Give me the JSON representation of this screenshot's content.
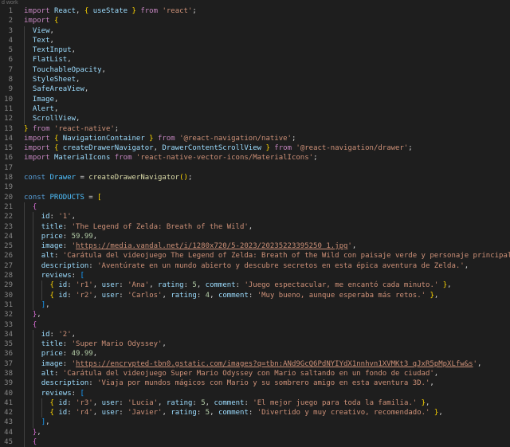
{
  "window": {
    "title": "d work"
  },
  "colors": {
    "background": "#1e1e1e",
    "line_number": "#858585",
    "keyword": "#c586c0",
    "declaration": "#569cd6",
    "variable": "#9cdcfe",
    "constant": "#4fc1ff",
    "function": "#dcdcaa",
    "type": "#4ec9b0",
    "string": "#ce9178",
    "number": "#b5cea8",
    "text": "#d4d4d4"
  },
  "editor": {
    "lines": [
      {
        "n": "1",
        "indent": 0,
        "tokens": [
          [
            "keyword",
            "import "
          ],
          [
            "var",
            "React"
          ],
          [
            "punct",
            ", "
          ],
          [
            "bracket1",
            "{ "
          ],
          [
            "var",
            "useState"
          ],
          [
            "bracket1",
            " }"
          ],
          [
            "keyword",
            " from "
          ],
          [
            "string",
            "'react'"
          ],
          [
            "punct",
            ";"
          ]
        ]
      },
      {
        "n": "2",
        "indent": 0,
        "tokens": [
          [
            "keyword",
            "import "
          ],
          [
            "bracket1",
            "{"
          ]
        ]
      },
      {
        "n": "3",
        "indent": 1,
        "tokens": [
          [
            "var",
            "View"
          ],
          [
            "punct",
            ","
          ]
        ]
      },
      {
        "n": "4",
        "indent": 1,
        "tokens": [
          [
            "var",
            "Text"
          ],
          [
            "punct",
            ","
          ]
        ]
      },
      {
        "n": "5",
        "indent": 1,
        "tokens": [
          [
            "var",
            "TextInput"
          ],
          [
            "punct",
            ","
          ]
        ]
      },
      {
        "n": "6",
        "indent": 1,
        "tokens": [
          [
            "var",
            "FlatList"
          ],
          [
            "punct",
            ","
          ]
        ]
      },
      {
        "n": "7",
        "indent": 1,
        "tokens": [
          [
            "var",
            "TouchableOpacity"
          ],
          [
            "punct",
            ","
          ]
        ]
      },
      {
        "n": "8",
        "indent": 1,
        "tokens": [
          [
            "var",
            "StyleSheet"
          ],
          [
            "punct",
            ","
          ]
        ]
      },
      {
        "n": "9",
        "indent": 1,
        "tokens": [
          [
            "var",
            "SafeAreaView"
          ],
          [
            "punct",
            ","
          ]
        ]
      },
      {
        "n": "10",
        "indent": 1,
        "tokens": [
          [
            "var",
            "Image"
          ],
          [
            "punct",
            ","
          ]
        ]
      },
      {
        "n": "11",
        "indent": 1,
        "tokens": [
          [
            "var",
            "Alert"
          ],
          [
            "punct",
            ","
          ]
        ]
      },
      {
        "n": "12",
        "indent": 1,
        "tokens": [
          [
            "var",
            "ScrollView"
          ],
          [
            "punct",
            ","
          ]
        ]
      },
      {
        "n": "13",
        "indent": 0,
        "tokens": [
          [
            "bracket1",
            "}"
          ],
          [
            "keyword",
            " from "
          ],
          [
            "string",
            "'react-native'"
          ],
          [
            "punct",
            ";"
          ]
        ]
      },
      {
        "n": "14",
        "indent": 0,
        "tokens": [
          [
            "keyword",
            "import "
          ],
          [
            "bracket1",
            "{ "
          ],
          [
            "var",
            "NavigationContainer"
          ],
          [
            "bracket1",
            " }"
          ],
          [
            "keyword",
            " from "
          ],
          [
            "string",
            "'@react-navigation/native'"
          ],
          [
            "punct",
            ";"
          ]
        ]
      },
      {
        "n": "15",
        "indent": 0,
        "tokens": [
          [
            "keyword",
            "import "
          ],
          [
            "bracket1",
            "{ "
          ],
          [
            "var",
            "createDrawerNavigator"
          ],
          [
            "punct",
            ", "
          ],
          [
            "var",
            "DrawerContentScrollView"
          ],
          [
            "bracket1",
            " }"
          ],
          [
            "keyword",
            " from "
          ],
          [
            "string",
            "'@react-navigation/drawer'"
          ],
          [
            "punct",
            ";"
          ]
        ]
      },
      {
        "n": "16",
        "indent": 0,
        "tokens": [
          [
            "keyword",
            "import "
          ],
          [
            "var",
            "MaterialIcons"
          ],
          [
            "keyword",
            " from "
          ],
          [
            "string",
            "'react-native-vector-icons/MaterialIcons'"
          ],
          [
            "punct",
            ";"
          ]
        ]
      },
      {
        "n": "17",
        "indent": 0,
        "tokens": []
      },
      {
        "n": "18",
        "indent": 0,
        "tokens": [
          [
            "decl",
            "const "
          ],
          [
            "const",
            "Drawer"
          ],
          [
            "punct",
            " = "
          ],
          [
            "fn",
            "createDrawerNavigator"
          ],
          [
            "bracket1",
            "()"
          ],
          [
            "punct",
            ";"
          ]
        ]
      },
      {
        "n": "19",
        "indent": 0,
        "tokens": []
      },
      {
        "n": "20",
        "indent": 0,
        "tokens": [
          [
            "decl",
            "const "
          ],
          [
            "const",
            "PRODUCTS"
          ],
          [
            "punct",
            " = "
          ],
          [
            "bracket1",
            "["
          ]
        ]
      },
      {
        "n": "21",
        "indent": 1,
        "tokens": [
          [
            "bracket2",
            "{"
          ]
        ]
      },
      {
        "n": "22",
        "indent": 2,
        "tokens": [
          [
            "var",
            "id"
          ],
          [
            "punct",
            ": "
          ],
          [
            "string",
            "'1'"
          ],
          [
            "punct",
            ","
          ]
        ]
      },
      {
        "n": "23",
        "indent": 2,
        "tokens": [
          [
            "var",
            "title"
          ],
          [
            "punct",
            ": "
          ],
          [
            "string",
            "'The Legend of Zelda: Breath of the Wild'"
          ],
          [
            "punct",
            ","
          ]
        ]
      },
      {
        "n": "24",
        "indent": 2,
        "tokens": [
          [
            "var",
            "price"
          ],
          [
            "punct",
            ": "
          ],
          [
            "number",
            "59.99"
          ],
          [
            "punct",
            ","
          ]
        ]
      },
      {
        "n": "25",
        "indent": 2,
        "tokens": [
          [
            "var",
            "image"
          ],
          [
            "punct",
            ": "
          ],
          [
            "string",
            "'"
          ],
          [
            "link",
            "https://media.vandal.net/i/1280x720/5-2023/20235223395250_1.jpg"
          ],
          [
            "string",
            "'"
          ],
          [
            "punct",
            ","
          ]
        ]
      },
      {
        "n": "26",
        "indent": 2,
        "tokens": [
          [
            "var",
            "alt"
          ],
          [
            "punct",
            ": "
          ],
          [
            "string",
            "'Carátula del videojuego The Legend of Zelda: Breath of the Wild con paisaje verde y personaje principal'"
          ],
          [
            "punct",
            ","
          ]
        ]
      },
      {
        "n": "27",
        "indent": 2,
        "tokens": [
          [
            "var",
            "description"
          ],
          [
            "punct",
            ": "
          ],
          [
            "string",
            "'Aventúrate en un mundo abierto y descubre secretos en esta épica aventura de Zelda.'"
          ],
          [
            "punct",
            ","
          ]
        ]
      },
      {
        "n": "28",
        "indent": 2,
        "tokens": [
          [
            "var",
            "reviews"
          ],
          [
            "punct",
            ": "
          ],
          [
            "bracket3",
            "["
          ]
        ]
      },
      {
        "n": "29",
        "indent": 3,
        "tokens": [
          [
            "bracket1",
            "{ "
          ],
          [
            "var",
            "id"
          ],
          [
            "punct",
            ": "
          ],
          [
            "string",
            "'r1'"
          ],
          [
            "punct",
            ", "
          ],
          [
            "var",
            "user"
          ],
          [
            "punct",
            ": "
          ],
          [
            "string",
            "'Ana'"
          ],
          [
            "punct",
            ", "
          ],
          [
            "var",
            "rating"
          ],
          [
            "punct",
            ": "
          ],
          [
            "number",
            "5"
          ],
          [
            "punct",
            ", "
          ],
          [
            "var",
            "comment"
          ],
          [
            "punct",
            ": "
          ],
          [
            "string",
            "'Juego espectacular, me encantó cada minuto.'"
          ],
          [
            "bracket1",
            " }"
          ],
          [
            "punct",
            ","
          ]
        ]
      },
      {
        "n": "30",
        "indent": 3,
        "tokens": [
          [
            "bracket1",
            "{ "
          ],
          [
            "var",
            "id"
          ],
          [
            "punct",
            ": "
          ],
          [
            "string",
            "'r2'"
          ],
          [
            "punct",
            ", "
          ],
          [
            "var",
            "user"
          ],
          [
            "punct",
            ": "
          ],
          [
            "string",
            "'Carlos'"
          ],
          [
            "punct",
            ", "
          ],
          [
            "var",
            "rating"
          ],
          [
            "punct",
            ": "
          ],
          [
            "number",
            "4"
          ],
          [
            "punct",
            ", "
          ],
          [
            "var",
            "comment"
          ],
          [
            "punct",
            ": "
          ],
          [
            "string",
            "'Muy bueno, aunque esperaba más retos.'"
          ],
          [
            "bracket1",
            " }"
          ],
          [
            "punct",
            ","
          ]
        ]
      },
      {
        "n": "31",
        "indent": 2,
        "tokens": [
          [
            "bracket3",
            "]"
          ],
          [
            "punct",
            ","
          ]
        ]
      },
      {
        "n": "32",
        "indent": 1,
        "tokens": [
          [
            "bracket2",
            "}"
          ],
          [
            "punct",
            ","
          ]
        ]
      },
      {
        "n": "33",
        "indent": 1,
        "tokens": [
          [
            "bracket2",
            "{"
          ]
        ]
      },
      {
        "n": "34",
        "indent": 2,
        "tokens": [
          [
            "var",
            "id"
          ],
          [
            "punct",
            ": "
          ],
          [
            "string",
            "'2'"
          ],
          [
            "punct",
            ","
          ]
        ]
      },
      {
        "n": "35",
        "indent": 2,
        "tokens": [
          [
            "var",
            "title"
          ],
          [
            "punct",
            ": "
          ],
          [
            "string",
            "'Super Mario Odyssey'"
          ],
          [
            "punct",
            ","
          ]
        ]
      },
      {
        "n": "36",
        "indent": 2,
        "tokens": [
          [
            "var",
            "price"
          ],
          [
            "punct",
            ": "
          ],
          [
            "number",
            "49.99"
          ],
          [
            "punct",
            ","
          ]
        ]
      },
      {
        "n": "37",
        "indent": 2,
        "tokens": [
          [
            "var",
            "image"
          ],
          [
            "punct",
            ": "
          ],
          [
            "string",
            "'"
          ],
          [
            "link",
            "https://encrypted-tbn0.gstatic.com/images?q=tbn:ANd9GcQ6PdNYIYdX1nnhvn1XVMKt3_qJxR5pMpXLfw&s"
          ],
          [
            "string",
            "'"
          ],
          [
            "punct",
            ","
          ]
        ]
      },
      {
        "n": "38",
        "indent": 2,
        "tokens": [
          [
            "var",
            "alt"
          ],
          [
            "punct",
            ": "
          ],
          [
            "string",
            "'Carátula del videojuego Super Mario Odyssey con Mario saltando en un fondo de ciudad'"
          ],
          [
            "punct",
            ","
          ]
        ]
      },
      {
        "n": "39",
        "indent": 2,
        "tokens": [
          [
            "var",
            "description"
          ],
          [
            "punct",
            ": "
          ],
          [
            "string",
            "'Viaja por mundos mágicos con Mario y su sombrero amigo en esta aventura 3D.'"
          ],
          [
            "punct",
            ","
          ]
        ]
      },
      {
        "n": "40",
        "indent": 2,
        "tokens": [
          [
            "var",
            "reviews"
          ],
          [
            "punct",
            ": "
          ],
          [
            "bracket3",
            "["
          ]
        ]
      },
      {
        "n": "41",
        "indent": 3,
        "tokens": [
          [
            "bracket1",
            "{ "
          ],
          [
            "var",
            "id"
          ],
          [
            "punct",
            ": "
          ],
          [
            "string",
            "'r3'"
          ],
          [
            "punct",
            ", "
          ],
          [
            "var",
            "user"
          ],
          [
            "punct",
            ": "
          ],
          [
            "string",
            "'Lucia'"
          ],
          [
            "punct",
            ", "
          ],
          [
            "var",
            "rating"
          ],
          [
            "punct",
            ": "
          ],
          [
            "number",
            "5"
          ],
          [
            "punct",
            ", "
          ],
          [
            "var",
            "comment"
          ],
          [
            "punct",
            ": "
          ],
          [
            "string",
            "'El mejor juego para toda la familia.'"
          ],
          [
            "bracket1",
            " }"
          ],
          [
            "punct",
            ","
          ]
        ]
      },
      {
        "n": "42",
        "indent": 3,
        "tokens": [
          [
            "bracket1",
            "{ "
          ],
          [
            "var",
            "id"
          ],
          [
            "punct",
            ": "
          ],
          [
            "string",
            "'r4'"
          ],
          [
            "punct",
            ", "
          ],
          [
            "var",
            "user"
          ],
          [
            "punct",
            ": "
          ],
          [
            "string",
            "'Javier'"
          ],
          [
            "punct",
            ", "
          ],
          [
            "var",
            "rating"
          ],
          [
            "punct",
            ": "
          ],
          [
            "number",
            "5"
          ],
          [
            "punct",
            ", "
          ],
          [
            "var",
            "comment"
          ],
          [
            "punct",
            ": "
          ],
          [
            "string",
            "'Divertido y muy creativo, recomendado.'"
          ],
          [
            "bracket1",
            " }"
          ],
          [
            "punct",
            ","
          ]
        ]
      },
      {
        "n": "43",
        "indent": 2,
        "tokens": [
          [
            "bracket3",
            "]"
          ],
          [
            "punct",
            ","
          ]
        ]
      },
      {
        "n": "44",
        "indent": 1,
        "tokens": [
          [
            "bracket2",
            "}"
          ],
          [
            "punct",
            ","
          ]
        ]
      },
      {
        "n": "45",
        "indent": 1,
        "tokens": [
          [
            "bracket2",
            "{"
          ]
        ]
      }
    ]
  }
}
